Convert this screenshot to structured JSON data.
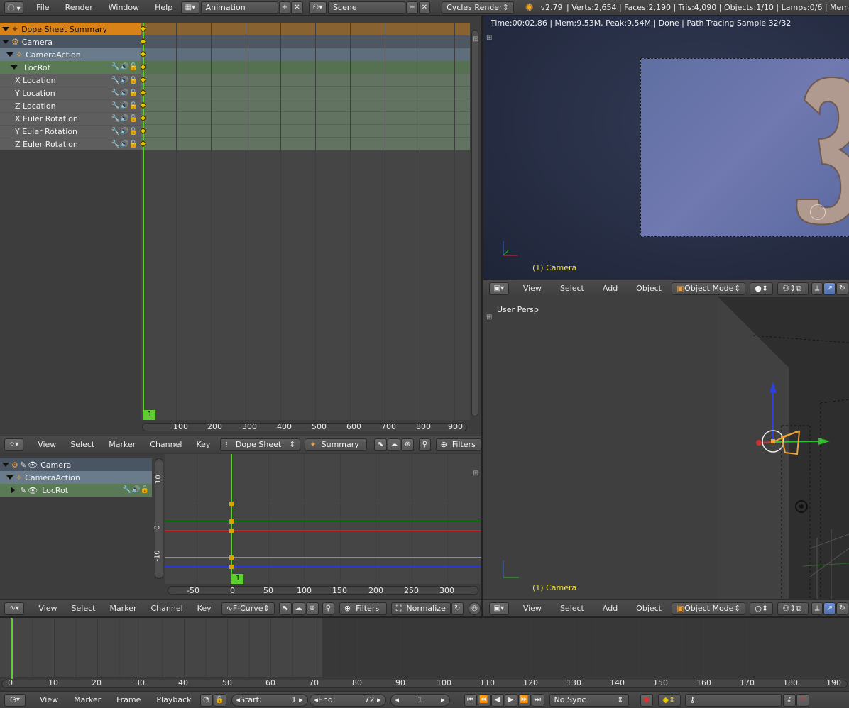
{
  "menubar": {
    "items": [
      "File",
      "Render",
      "Window",
      "Help"
    ],
    "screen_layout": "Animation",
    "scene": "Scene",
    "render_engine": "Cycles Render",
    "version": "v2.79",
    "stats": "Verts:2,654 | Faces:2,190 | Tris:4,090 | Objects:1/10 | Lamps:0/6 | Mem"
  },
  "dopesheet": {
    "channels": [
      {
        "label": "Dope Sheet Summary",
        "type": "summary"
      },
      {
        "label": "Camera",
        "type": "object"
      },
      {
        "label": "CameraAction",
        "type": "action"
      },
      {
        "label": "LocRot",
        "type": "group"
      },
      {
        "label": "X Location",
        "type": "fcurve"
      },
      {
        "label": "Y Location",
        "type": "fcurve"
      },
      {
        "label": "Z Location",
        "type": "fcurve"
      },
      {
        "label": "X Euler Rotation",
        "type": "fcurve"
      },
      {
        "label": "Y Euler Rotation",
        "type": "fcurve"
      },
      {
        "label": "Z Euler Rotation",
        "type": "fcurve"
      }
    ],
    "current_frame": "1",
    "ruler": [
      "100",
      "200",
      "300",
      "400",
      "500",
      "600",
      "700",
      "800",
      "900"
    ],
    "header": {
      "menus": [
        "View",
        "Select",
        "Marker",
        "Channel",
        "Key"
      ],
      "mode": "Dope Sheet",
      "summary": "Summary",
      "filters": "Filters"
    }
  },
  "graph": {
    "channels": [
      {
        "label": "Camera",
        "type": "object"
      },
      {
        "label": "CameraAction",
        "type": "action"
      },
      {
        "label": "LocRot",
        "type": "group"
      }
    ],
    "y_ticks": [
      "10",
      "0",
      "-10"
    ],
    "x_ticks": [
      "-50",
      "0",
      "50",
      "100",
      "150",
      "200",
      "250",
      "300"
    ],
    "current_frame": "1",
    "header": {
      "menus": [
        "View",
        "Select",
        "Marker",
        "Channel",
        "Key"
      ],
      "mode": "F-Curve",
      "filters": "Filters",
      "normalize": "Normalize"
    }
  },
  "camera_view": {
    "render_info": "Time:00:02.86 | Mem:9.53M, Peak:9.54M | Done | Path Tracing Sample 32/32",
    "object_label": "(1) Camera",
    "header": {
      "menus": [
        "View",
        "Select",
        "Add",
        "Object"
      ],
      "mode": "Object Mode"
    }
  },
  "persp_view": {
    "title": "User Persp",
    "object_label": "(1) Camera",
    "header": {
      "menus": [
        "View",
        "Select",
        "Add",
        "Object"
      ],
      "mode": "Object Mode"
    }
  },
  "timeline": {
    "ruler": [
      "0",
      "10",
      "20",
      "30",
      "40",
      "50",
      "60",
      "70",
      "80",
      "90",
      "100",
      "110",
      "120",
      "130",
      "140",
      "150",
      "160",
      "170",
      "180",
      "190"
    ],
    "header": {
      "menus": [
        "View",
        "Marker",
        "Frame",
        "Playback"
      ],
      "start_label": "Start:",
      "start_value": "1",
      "end_label": "End:",
      "end_value": "72",
      "current_frame": "1",
      "sync": "No Sync"
    }
  },
  "colors": {
    "accent_orange": "#d98218",
    "keyframe_yellow": "#e6c500",
    "playhead_green": "#5fcf2f",
    "object_label_yellow": "#f0e040"
  }
}
